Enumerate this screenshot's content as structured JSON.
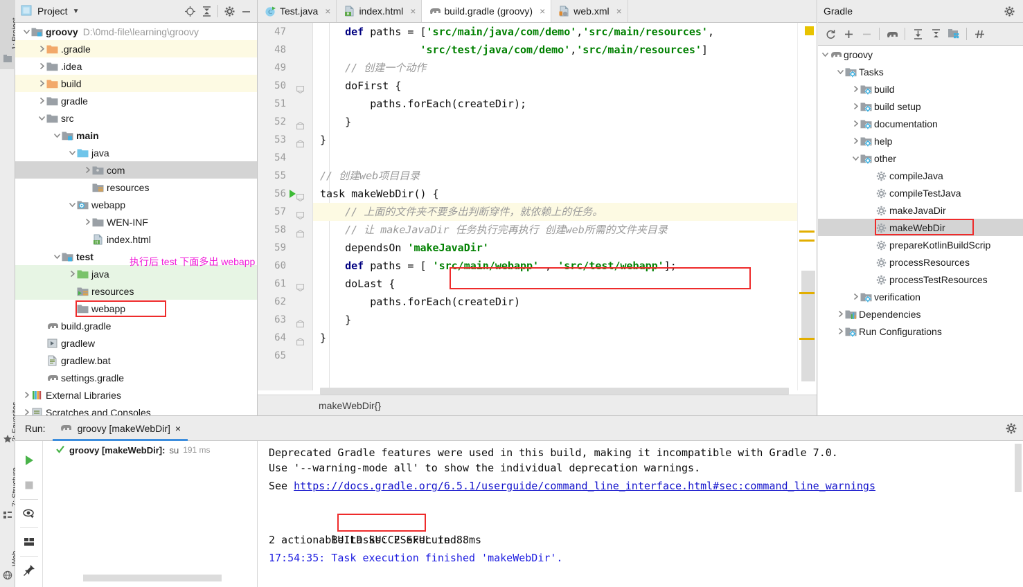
{
  "rail": {
    "items": [
      {
        "label": "1: Project",
        "icon": "project-icon",
        "active": true
      },
      {
        "label": "2: Favorites",
        "icon": "star-icon",
        "active": false
      },
      {
        "label": "7: Structure",
        "icon": "structure-icon",
        "active": false
      },
      {
        "label": "Web",
        "icon": "web-icon",
        "active": false
      }
    ]
  },
  "project_panel": {
    "title": "Project",
    "caret": "▼",
    "icons": [
      "locate-icon",
      "collapse-all-icon",
      "gear-icon",
      "minimize-icon"
    ],
    "tree": [
      {
        "label": "groovy",
        "path": "D:\\0md-file\\learning\\groovy",
        "indent": 0,
        "arrow": "down",
        "icon": "module-folder",
        "bold": true,
        "hl": "none"
      },
      {
        "label": ".gradle",
        "indent": 1,
        "arrow": "right",
        "icon": "folder-orange",
        "hl": "yellow"
      },
      {
        "label": ".idea",
        "indent": 1,
        "arrow": "right",
        "icon": "folder-gray",
        "hl": "none"
      },
      {
        "label": "build",
        "indent": 1,
        "arrow": "right",
        "icon": "folder-orange",
        "hl": "yellow"
      },
      {
        "label": "gradle",
        "indent": 1,
        "arrow": "right",
        "icon": "folder-gray",
        "hl": "none"
      },
      {
        "label": "src",
        "indent": 1,
        "arrow": "down",
        "icon": "folder-gray",
        "hl": "none"
      },
      {
        "label": "main",
        "indent": 2,
        "arrow": "down",
        "icon": "module-folder",
        "bold": true,
        "hl": "none"
      },
      {
        "label": "java",
        "indent": 3,
        "arrow": "down",
        "icon": "folder-blue",
        "hl": "none"
      },
      {
        "label": "com",
        "indent": 4,
        "arrow": "right",
        "icon": "folder-gray-dot",
        "hl": "selected"
      },
      {
        "label": "resources",
        "indent": 4,
        "arrow": "none",
        "icon": "folder-resources",
        "hl": "none"
      },
      {
        "label": "webapp",
        "indent": 3,
        "arrow": "down",
        "icon": "folder-web",
        "hl": "none"
      },
      {
        "label": "WEN-INF",
        "indent": 4,
        "arrow": "right",
        "icon": "folder-gray",
        "hl": "none"
      },
      {
        "label": "index.html",
        "indent": 4,
        "arrow": "none",
        "icon": "html-file",
        "hl": "none"
      },
      {
        "label": "test",
        "indent": 2,
        "arrow": "down",
        "icon": "module-folder",
        "bold": true,
        "hl": "none"
      },
      {
        "label": "java",
        "indent": 3,
        "arrow": "right",
        "icon": "folder-green",
        "hl": "green"
      },
      {
        "label": "resources",
        "indent": 3,
        "arrow": "none",
        "icon": "folder-test-resources",
        "hl": "green"
      },
      {
        "label": "webapp",
        "indent": 3,
        "arrow": "none",
        "icon": "folder-gray",
        "hl": "none",
        "boxed": true
      },
      {
        "label": "build.gradle",
        "indent": 1,
        "arrow": "none",
        "icon": "gradle-file",
        "hl": "none"
      },
      {
        "label": "gradlew",
        "indent": 1,
        "arrow": "none",
        "icon": "script-file",
        "hl": "none"
      },
      {
        "label": "gradlew.bat",
        "indent": 1,
        "arrow": "none",
        "icon": "bat-file",
        "hl": "none"
      },
      {
        "label": "settings.gradle",
        "indent": 1,
        "arrow": "none",
        "icon": "gradle-file",
        "hl": "none"
      },
      {
        "label": "External Libraries",
        "indent": 0,
        "arrow": "right",
        "icon": "libraries-icon",
        "hl": "none"
      },
      {
        "label": "Scratches and Consoles",
        "indent": 0,
        "arrow": "right",
        "icon": "scratches-icon",
        "hl": "none"
      }
    ],
    "annotation": "执行后 test 下面多出 webapp 文件夹"
  },
  "editor": {
    "tabs": [
      {
        "label": "Test.java",
        "icon": "java-class-icon",
        "active": false,
        "close": "×"
      },
      {
        "label": "index.html",
        "icon": "html-file-icon",
        "active": false,
        "close": "×"
      },
      {
        "label": "build.gradle (groovy)",
        "icon": "gradle-file-icon",
        "active": true,
        "close": "×"
      },
      {
        "label": "web.xml",
        "icon": "xml-file-icon",
        "active": false,
        "close": "×"
      }
    ],
    "first_line_number": 47,
    "lines": [
      {
        "n": 47,
        "segments": [
          {
            "t": "    ",
            "c": ""
          },
          {
            "t": "def",
            "c": "kw"
          },
          {
            "t": " paths = [",
            "c": ""
          },
          {
            "t": "'src/main/java/com/demo'",
            "c": "str"
          },
          {
            "t": ",",
            "c": ""
          },
          {
            "t": "'src/main/resources'",
            "c": "str"
          },
          {
            "t": ",",
            "c": ""
          }
        ],
        "warn": false,
        "fold": "none",
        "run": false
      },
      {
        "n": 48,
        "segments": [
          {
            "t": "                ",
            "c": ""
          },
          {
            "t": "'src/test/java/com/demo'",
            "c": "str"
          },
          {
            "t": ",",
            "c": ""
          },
          {
            "t": "'src/main/resources'",
            "c": "str"
          },
          {
            "t": "]",
            "c": ""
          }
        ],
        "warn": false,
        "fold": "none",
        "run": false
      },
      {
        "n": 49,
        "segments": [
          {
            "t": "    // 创建一个动作",
            "c": "cmt"
          }
        ],
        "warn": false,
        "fold": "none",
        "run": false
      },
      {
        "n": 50,
        "segments": [
          {
            "t": "    doFirst {",
            "c": ""
          }
        ],
        "warn": false,
        "fold": "open",
        "run": false
      },
      {
        "n": 51,
        "segments": [
          {
            "t": "        paths.forEach(createDir);",
            "c": ""
          }
        ],
        "warn": false,
        "fold": "none",
        "run": false
      },
      {
        "n": 52,
        "segments": [
          {
            "t": "    }",
            "c": ""
          }
        ],
        "warn": false,
        "fold": "close",
        "run": false
      },
      {
        "n": 53,
        "segments": [
          {
            "t": "}",
            "c": ""
          }
        ],
        "warn": false,
        "fold": "close",
        "run": false
      },
      {
        "n": 54,
        "segments": [
          {
            "t": "",
            "c": ""
          }
        ],
        "warn": false,
        "fold": "none",
        "run": false
      },
      {
        "n": 55,
        "segments": [
          {
            "t": "// 创建web项目目录",
            "c": "cmt"
          }
        ],
        "warn": false,
        "fold": "none",
        "run": false
      },
      {
        "n": 56,
        "segments": [
          {
            "t": "task makeWebDir() {",
            "c": ""
          }
        ],
        "warn": false,
        "fold": "open",
        "run": true
      },
      {
        "n": 57,
        "segments": [
          {
            "t": "    // 上面的文件夹不要多出判断穿件，就依赖上的任务。",
            "c": "cmt"
          }
        ],
        "warn": true,
        "fold": "open",
        "run": false
      },
      {
        "n": 58,
        "segments": [
          {
            "t": "    // 让 makeJavaDir 任务执行完再执行 创建web所需的文件夹目录",
            "c": "cmt"
          }
        ],
        "warn": false,
        "fold": "close",
        "run": false
      },
      {
        "n": 59,
        "segments": [
          {
            "t": "    dependsOn ",
            "c": ""
          },
          {
            "t": "'makeJavaDir'",
            "c": "str"
          }
        ],
        "warn": false,
        "fold": "none",
        "run": false
      },
      {
        "n": 60,
        "segments": [
          {
            "t": "    ",
            "c": ""
          },
          {
            "t": "def",
            "c": "kw"
          },
          {
            "t": " paths = [ ",
            "c": ""
          },
          {
            "t": "'src/main/webapp'",
            "c": "str"
          },
          {
            "t": " , ",
            "c": ""
          },
          {
            "t": "'src/test/webapp'",
            "c": "str"
          },
          {
            "t": "];",
            "c": ""
          }
        ],
        "warn": false,
        "fold": "none",
        "run": false
      },
      {
        "n": 61,
        "segments": [
          {
            "t": "    doLast {",
            "c": ""
          }
        ],
        "warn": false,
        "fold": "open",
        "run": false
      },
      {
        "n": 62,
        "segments": [
          {
            "t": "        paths.forEach(createDir)",
            "c": ""
          }
        ],
        "warn": false,
        "fold": "none",
        "run": false
      },
      {
        "n": 63,
        "segments": [
          {
            "t": "    }",
            "c": ""
          }
        ],
        "warn": false,
        "fold": "close",
        "run": false
      },
      {
        "n": 64,
        "segments": [
          {
            "t": "}",
            "c": ""
          }
        ],
        "warn": false,
        "fold": "close",
        "run": false
      },
      {
        "n": 65,
        "segments": [
          {
            "t": "",
            "c": ""
          }
        ],
        "warn": false,
        "fold": "none",
        "run": false
      }
    ],
    "breadcrumb": "makeWebDir{}"
  },
  "gradle_panel": {
    "title": "Gradle",
    "gear": "gear-icon",
    "toolbar": [
      "refresh-icon",
      "add-icon",
      "remove-icon",
      "elephant-icon",
      "expand-all-icon",
      "collapse-all-icon",
      "tasks-icon",
      "toggle-offline-icon"
    ],
    "tree": [
      {
        "label": "groovy",
        "indent": 0,
        "arrow": "down",
        "icon": "elephant-icon",
        "sel": false
      },
      {
        "label": "Tasks",
        "indent": 1,
        "arrow": "down",
        "icon": "tasks-folder",
        "sel": false
      },
      {
        "label": "build",
        "indent": 2,
        "arrow": "right",
        "icon": "tasks-folder",
        "sel": false
      },
      {
        "label": "build setup",
        "indent": 2,
        "arrow": "right",
        "icon": "tasks-folder",
        "sel": false
      },
      {
        "label": "documentation",
        "indent": 2,
        "arrow": "right",
        "icon": "tasks-folder",
        "sel": false
      },
      {
        "label": "help",
        "indent": 2,
        "arrow": "right",
        "icon": "tasks-folder",
        "sel": false
      },
      {
        "label": "other",
        "indent": 2,
        "arrow": "down",
        "icon": "tasks-folder",
        "sel": false
      },
      {
        "label": "compileJava",
        "indent": 3,
        "arrow": "none",
        "icon": "gear-task",
        "sel": false
      },
      {
        "label": "compileTestJava",
        "indent": 3,
        "arrow": "none",
        "icon": "gear-task",
        "sel": false
      },
      {
        "label": "makeJavaDir",
        "indent": 3,
        "arrow": "none",
        "icon": "gear-task",
        "sel": false
      },
      {
        "label": "makeWebDir",
        "indent": 3,
        "arrow": "none",
        "icon": "gear-task",
        "sel": true,
        "boxed": true
      },
      {
        "label": "prepareKotlinBuildScrip",
        "indent": 3,
        "arrow": "none",
        "icon": "gear-task",
        "sel": false
      },
      {
        "label": "processResources",
        "indent": 3,
        "arrow": "none",
        "icon": "gear-task",
        "sel": false
      },
      {
        "label": "processTestResources",
        "indent": 3,
        "arrow": "none",
        "icon": "gear-task",
        "sel": false
      },
      {
        "label": "verification",
        "indent": 2,
        "arrow": "right",
        "icon": "tasks-folder",
        "sel": false
      },
      {
        "label": "Dependencies",
        "indent": 1,
        "arrow": "right",
        "icon": "dependencies-folder",
        "sel": false
      },
      {
        "label": "Run Configurations",
        "indent": 1,
        "arrow": "right",
        "icon": "tasks-folder",
        "sel": false
      }
    ]
  },
  "run_panel": {
    "label": "Run:",
    "tab": {
      "label": "groovy [makeWebDir]",
      "icon": "elephant-icon",
      "close": "×"
    },
    "gear": "gear-icon",
    "tools": [
      "run-icon",
      "stop-icon",
      "filter-icon",
      "layout-icon",
      "pin-icon"
    ],
    "tree_row": {
      "status_icon": "check-icon",
      "name": "groovy [makeWebDir]:",
      "state": "su",
      "duration": "191 ms"
    },
    "console": [
      {
        "text": "Deprecated Gradle features were used in this build, making it incompatible with Gradle 7.0.",
        "style": "plain"
      },
      {
        "text": "Use '--warning-mode all' to show the individual deprecation warnings.",
        "style": "plain"
      },
      {
        "prefix": "See ",
        "link": "https://docs.gradle.org/6.5.1/userguide/command_line_interface.html#sec:command_line_warnings",
        "style": "link"
      },
      {
        "text": "",
        "style": "plain"
      },
      {
        "text": "BUILD SUCCESSFUL in 88ms",
        "style": "build",
        "boxed_word": "SUCCESSFUL"
      },
      {
        "text": "2 actionable tasks: 2 executed",
        "style": "plain"
      },
      {
        "text": "17:54:35: Task execution finished 'makeWebDir'.",
        "style": "blue"
      }
    ]
  },
  "colors": {
    "accent": "#3c8ddd",
    "annotation_red": "#ee2b2b",
    "annotation_magenta": "#f018d8",
    "string_green": "#008000",
    "keyword_navy": "#000080",
    "comment_gray": "#9a9a9a",
    "highlight_yellow": "#fdfae3",
    "highlight_green": "#e7f5e4",
    "selection_gray": "#d4d4d4"
  }
}
